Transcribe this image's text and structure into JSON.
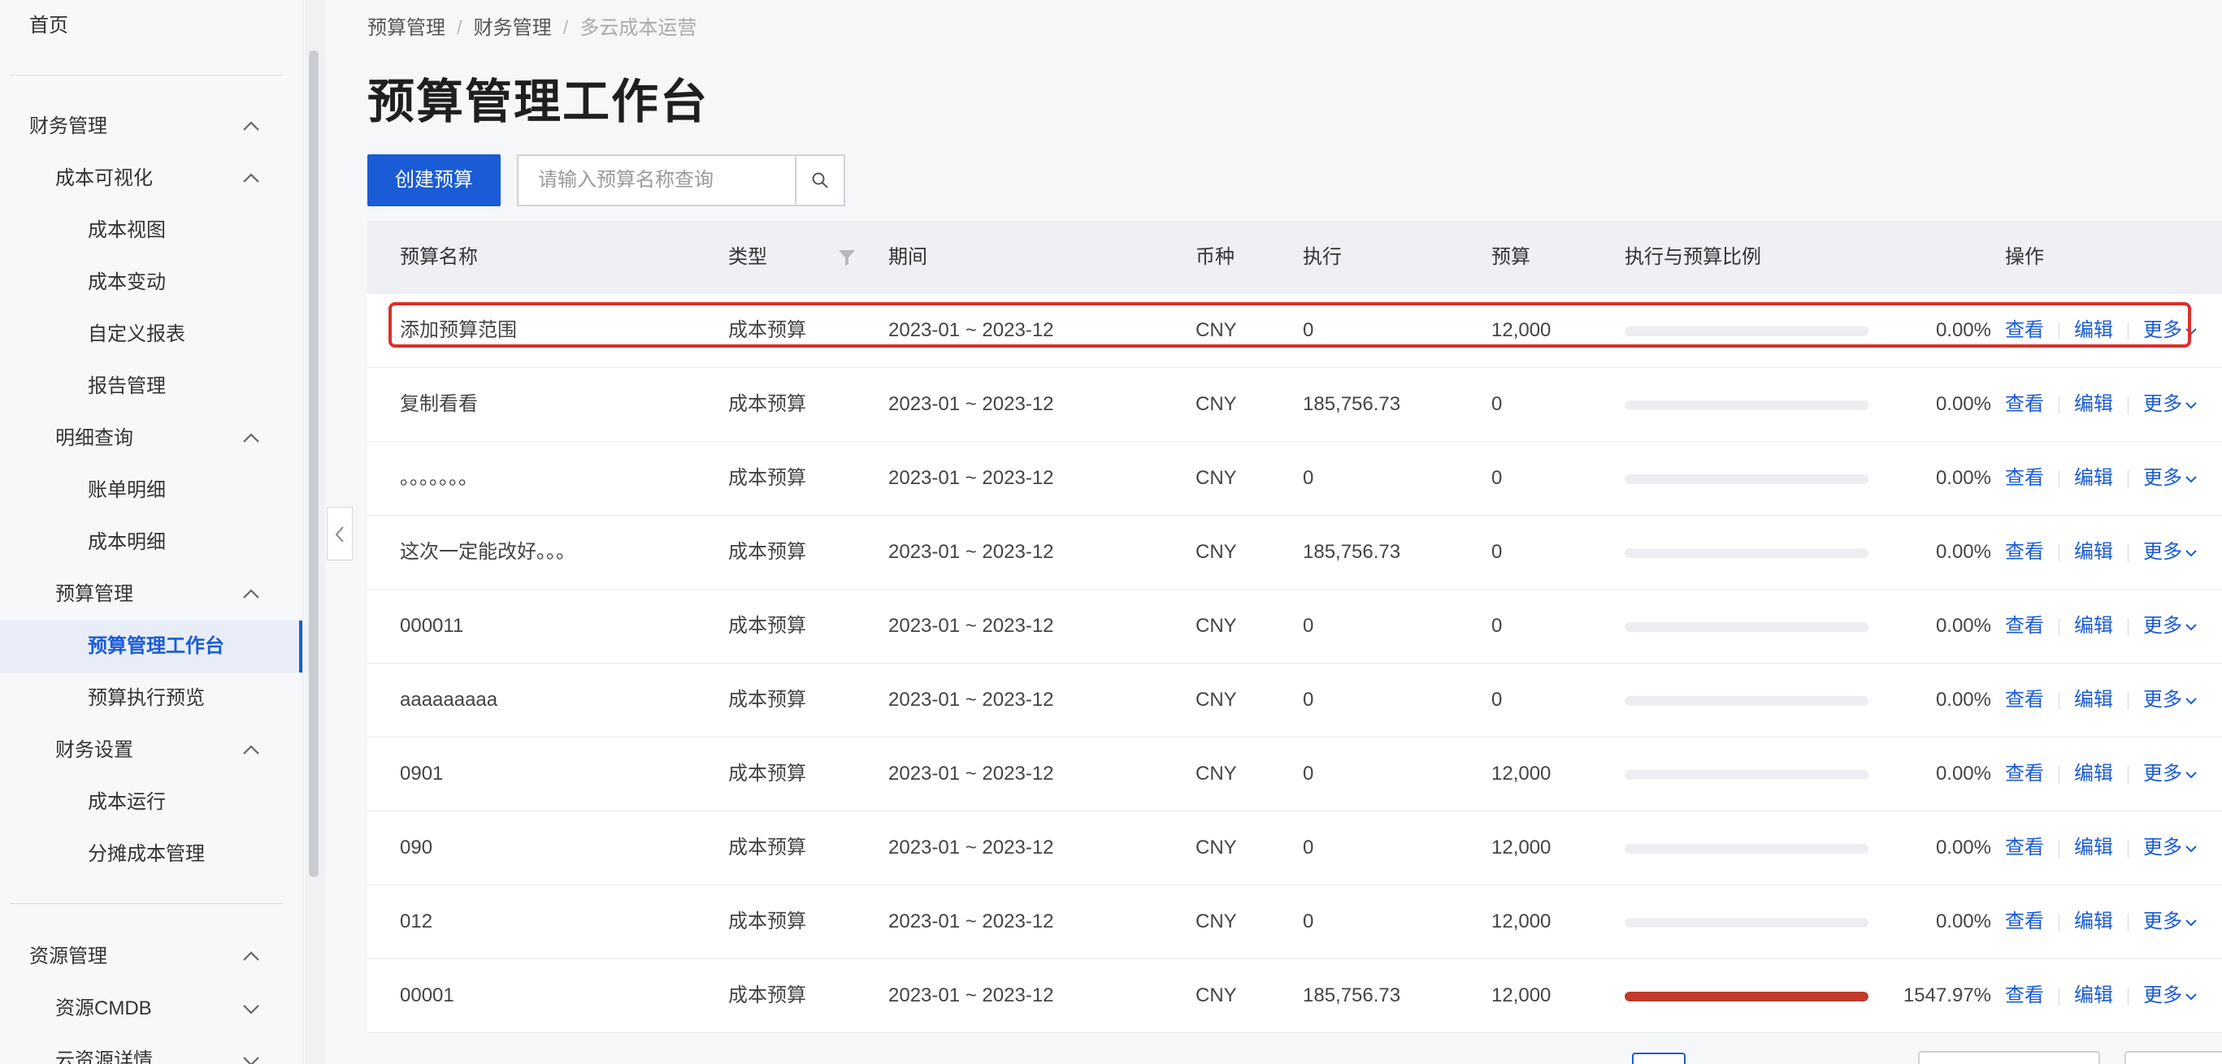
{
  "sidebar": {
    "home": "首页",
    "finance": "财务管理",
    "cost_visual": "成本可视化",
    "cost_view": "成本视图",
    "cost_change": "成本变动",
    "custom_report": "自定义报表",
    "report_mgmt": "报告管理",
    "detail_query": "明细查询",
    "bill_detail": "账单明细",
    "cost_detail": "成本明细",
    "budget_mgmt": "预算管理",
    "budget_workbench": "预算管理工作台",
    "budget_preview": "预算执行预览",
    "finance_settings": "财务设置",
    "cost_run": "成本运行",
    "allocation": "分摊成本管理",
    "resource_mgmt": "资源管理",
    "resource_cmdb": "资源CMDB",
    "cloud_resource": "云资源详情"
  },
  "breadcrumb": {
    "b1": "预算管理",
    "b2": "财务管理",
    "b3": "多云成本运营"
  },
  "title": "预算管理工作台",
  "toolbar": {
    "create_label": "创建预算",
    "search_placeholder": "请输入预算名称查询"
  },
  "table": {
    "headers": {
      "name": "预算名称",
      "type": "类型",
      "period": "期间",
      "currency": "币种",
      "exec": "执行",
      "budget": "预算",
      "ratio": "执行与预算比例",
      "ops": "操作"
    },
    "actions": {
      "view": "查看",
      "edit": "编辑",
      "more": "更多"
    },
    "rows": [
      {
        "name": "添加预算范围",
        "type": "成本预算",
        "period": "2023-01 ~ 2023-12",
        "currency": "CNY",
        "exec": "0",
        "budget": "12,000",
        "ratio": 0,
        "ratio_text": "0.00%"
      },
      {
        "name": "复制看看",
        "type": "成本预算",
        "period": "2023-01 ~ 2023-12",
        "currency": "CNY",
        "exec": "185,756.73",
        "budget": "0",
        "ratio": 0,
        "ratio_text": "0.00%"
      },
      {
        "name": "。。。。。。。",
        "type": "成本预算",
        "period": "2023-01 ~ 2023-12",
        "currency": "CNY",
        "exec": "0",
        "budget": "0",
        "ratio": 0,
        "ratio_text": "0.00%"
      },
      {
        "name": "这次一定能改好。。。",
        "type": "成本预算",
        "period": "2023-01 ~ 2023-12",
        "currency": "CNY",
        "exec": "185,756.73",
        "budget": "0",
        "ratio": 0,
        "ratio_text": "0.00%"
      },
      {
        "name": "000011",
        "type": "成本预算",
        "period": "2023-01 ~ 2023-12",
        "currency": "CNY",
        "exec": "0",
        "budget": "0",
        "ratio": 0,
        "ratio_text": "0.00%"
      },
      {
        "name": "aaaaaaaaa",
        "type": "成本预算",
        "period": "2023-01 ~ 2023-12",
        "currency": "CNY",
        "exec": "0",
        "budget": "0",
        "ratio": 0,
        "ratio_text": "0.00%"
      },
      {
        "name": "0901",
        "type": "成本预算",
        "period": "2023-01 ~ 2023-12",
        "currency": "CNY",
        "exec": "0",
        "budget": "12,000",
        "ratio": 0,
        "ratio_text": "0.00%"
      },
      {
        "name": "090",
        "type": "成本预算",
        "period": "2023-01 ~ 2023-12",
        "currency": "CNY",
        "exec": "0",
        "budget": "12,000",
        "ratio": 0,
        "ratio_text": "0.00%"
      },
      {
        "name": "012",
        "type": "成本预算",
        "period": "2023-01 ~ 2023-12",
        "currency": "CNY",
        "exec": "0",
        "budget": "12,000",
        "ratio": 0,
        "ratio_text": "0.00%"
      },
      {
        "name": "00001",
        "type": "成本预算",
        "period": "2023-01 ~ 2023-12",
        "currency": "CNY",
        "exec": "185,756.73",
        "budget": "12,000",
        "ratio": 1,
        "ratio_text": "1547.97%"
      }
    ]
  },
  "colors": {
    "accent": "#1a5bd6",
    "over_budget": "#c0392b",
    "highlight": "#d9302c"
  },
  "icons": {
    "search": "search-icon",
    "filter": "filter-icon",
    "collapse": "chevron-left-icon",
    "expand_up": "chevron-up-icon",
    "expand_down": "chevron-down-icon"
  }
}
